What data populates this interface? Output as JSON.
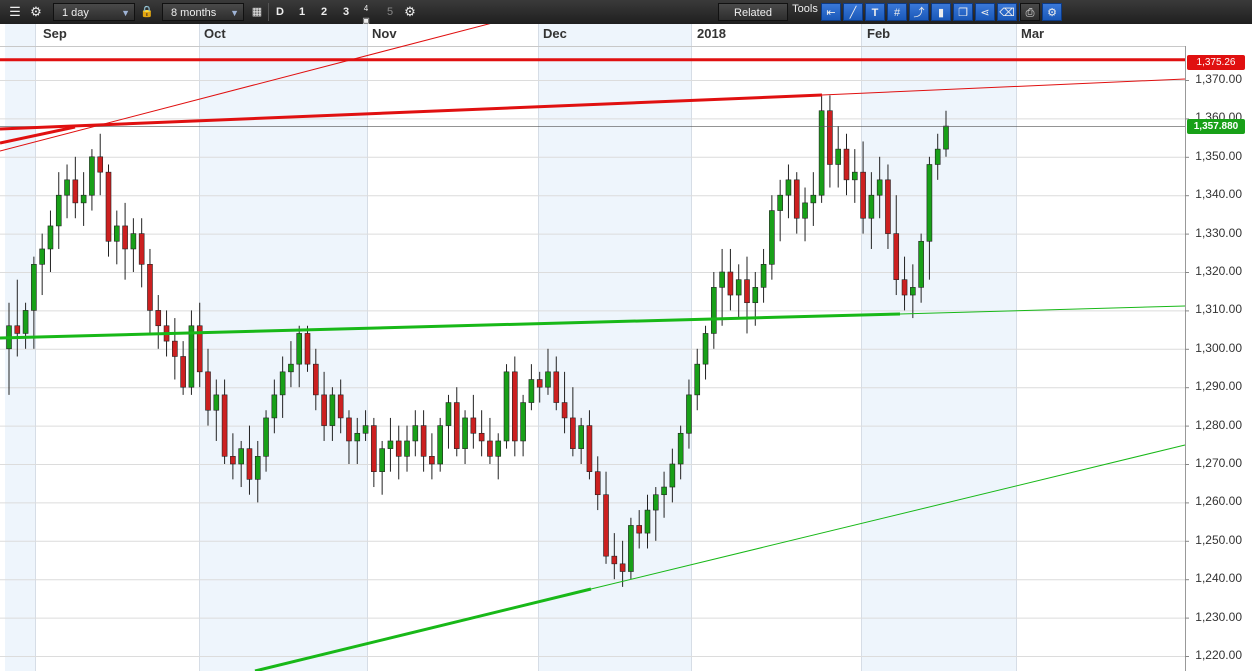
{
  "toolbar": {
    "interval": "1 day",
    "range": "8 months",
    "period_buttons": [
      "D",
      "1",
      "2",
      "3",
      "4",
      "5"
    ],
    "related_label": "Related",
    "tools_label": "Tools",
    "icons": [
      "list-icon",
      "gear-icon",
      "lock-icon",
      "calendar-icon",
      "settings-icon",
      "arrow-left-icon",
      "line-tool-icon",
      "text-tool-icon",
      "grid-icon",
      "trend-icon",
      "candle-icon",
      "copy-icon",
      "fork-icon",
      "eraser-icon",
      "brush-icon",
      "print-icon",
      "gear-icon"
    ]
  },
  "colors": {
    "up": "#18a018",
    "down": "#cc2020",
    "trend_red": "#e01010",
    "trend_green": "#18b818",
    "shade": "#eef5fc",
    "price_red": "#e01010",
    "price_green": "#18a018"
  },
  "chart_data": {
    "type": "candlestick",
    "instrument_price_last": "1,357.880",
    "resistance_level": "1,375.26",
    "x_labels": [
      "Sep",
      "Oct",
      "Nov",
      "Dec",
      "2018",
      "Feb",
      "Mar"
    ],
    "y_ticks": [
      "1,220.00",
      "1,230.00",
      "1,240.00",
      "1,250.00",
      "1,260.00",
      "1,270.00",
      "1,280.00",
      "1,290.00",
      "1,300.00",
      "1,310.00",
      "1,320.00",
      "1,330.00",
      "1,340.00",
      "1,350.00",
      "1,360.00",
      "1,370.00"
    ],
    "y_range": [
      1218,
      1385
    ],
    "candles": [
      [
        1300,
        1312,
        1288,
        1306
      ],
      [
        1306,
        1318,
        1298,
        1304
      ],
      [
        1304,
        1312,
        1300,
        1310
      ],
      [
        1310,
        1324,
        1300,
        1322
      ],
      [
        1322,
        1330,
        1314,
        1326
      ],
      [
        1326,
        1336,
        1320,
        1332
      ],
      [
        1332,
        1346,
        1326,
        1340
      ],
      [
        1340,
        1348,
        1334,
        1344
      ],
      [
        1344,
        1350,
        1334,
        1338
      ],
      [
        1338,
        1346,
        1332,
        1340
      ],
      [
        1340,
        1352,
        1336,
        1350
      ],
      [
        1350,
        1356,
        1340,
        1346
      ],
      [
        1346,
        1348,
        1324,
        1328
      ],
      [
        1328,
        1336,
        1322,
        1332
      ],
      [
        1332,
        1338,
        1318,
        1326
      ],
      [
        1326,
        1334,
        1320,
        1330
      ],
      [
        1330,
        1334,
        1316,
        1322
      ],
      [
        1322,
        1326,
        1304,
        1310
      ],
      [
        1310,
        1314,
        1300,
        1306
      ],
      [
        1306,
        1310,
        1298,
        1302
      ],
      [
        1302,
        1308,
        1292,
        1298
      ],
      [
        1298,
        1302,
        1288,
        1290
      ],
      [
        1290,
        1310,
        1288,
        1306
      ],
      [
        1306,
        1312,
        1290,
        1294
      ],
      [
        1294,
        1300,
        1280,
        1284
      ],
      [
        1284,
        1292,
        1276,
        1288
      ],
      [
        1288,
        1292,
        1270,
        1272
      ],
      [
        1272,
        1278,
        1266,
        1270
      ],
      [
        1270,
        1276,
        1264,
        1274
      ],
      [
        1274,
        1280,
        1262,
        1266
      ],
      [
        1266,
        1276,
        1260,
        1272
      ],
      [
        1272,
        1284,
        1268,
        1282
      ],
      [
        1282,
        1292,
        1278,
        1288
      ],
      [
        1288,
        1298,
        1282,
        1294
      ],
      [
        1294,
        1302,
        1290,
        1296
      ],
      [
        1296,
        1306,
        1290,
        1304
      ],
      [
        1304,
        1306,
        1294,
        1296
      ],
      [
        1296,
        1300,
        1284,
        1288
      ],
      [
        1288,
        1294,
        1276,
        1280
      ],
      [
        1280,
        1290,
        1276,
        1288
      ],
      [
        1288,
        1292,
        1278,
        1282
      ],
      [
        1282,
        1284,
        1270,
        1276
      ],
      [
        1276,
        1282,
        1270,
        1278
      ],
      [
        1278,
        1284,
        1276,
        1280
      ],
      [
        1280,
        1282,
        1264,
        1268
      ],
      [
        1268,
        1276,
        1262,
        1274
      ],
      [
        1274,
        1282,
        1268,
        1276
      ],
      [
        1276,
        1280,
        1266,
        1272
      ],
      [
        1272,
        1280,
        1268,
        1276
      ],
      [
        1276,
        1284,
        1272,
        1280
      ],
      [
        1280,
        1284,
        1268,
        1272
      ],
      [
        1272,
        1278,
        1266,
        1270
      ],
      [
        1270,
        1282,
        1268,
        1280
      ],
      [
        1280,
        1288,
        1274,
        1286
      ],
      [
        1286,
        1290,
        1272,
        1274
      ],
      [
        1274,
        1284,
        1270,
        1282
      ],
      [
        1282,
        1288,
        1274,
        1278
      ],
      [
        1278,
        1284,
        1272,
        1276
      ],
      [
        1276,
        1282,
        1270,
        1272
      ],
      [
        1272,
        1278,
        1266,
        1276
      ],
      [
        1276,
        1296,
        1274,
        1294
      ],
      [
        1294,
        1298,
        1272,
        1276
      ],
      [
        1276,
        1288,
        1272,
        1286
      ],
      [
        1286,
        1296,
        1284,
        1292
      ],
      [
        1292,
        1294,
        1286,
        1290
      ],
      [
        1290,
        1300,
        1288,
        1294
      ],
      [
        1294,
        1298,
        1284,
        1286
      ],
      [
        1286,
        1294,
        1278,
        1282
      ],
      [
        1282,
        1290,
        1272,
        1274
      ],
      [
        1274,
        1282,
        1270,
        1280
      ],
      [
        1280,
        1284,
        1266,
        1268
      ],
      [
        1268,
        1272,
        1258,
        1262
      ],
      [
        1262,
        1268,
        1244,
        1246
      ],
      [
        1246,
        1252,
        1240,
        1244
      ],
      [
        1244,
        1250,
        1238,
        1242
      ],
      [
        1242,
        1256,
        1240,
        1254
      ],
      [
        1254,
        1258,
        1248,
        1252
      ],
      [
        1252,
        1262,
        1248,
        1258
      ],
      [
        1258,
        1264,
        1250,
        1262
      ],
      [
        1262,
        1268,
        1256,
        1264
      ],
      [
        1264,
        1274,
        1260,
        1270
      ],
      [
        1270,
        1280,
        1266,
        1278
      ],
      [
        1278,
        1292,
        1274,
        1288
      ],
      [
        1288,
        1300,
        1284,
        1296
      ],
      [
        1296,
        1306,
        1292,
        1304
      ],
      [
        1304,
        1320,
        1300,
        1316
      ],
      [
        1316,
        1326,
        1306,
        1320
      ],
      [
        1320,
        1326,
        1310,
        1314
      ],
      [
        1314,
        1322,
        1308,
        1318
      ],
      [
        1318,
        1324,
        1304,
        1312
      ],
      [
        1312,
        1320,
        1306,
        1316
      ],
      [
        1316,
        1326,
        1312,
        1322
      ],
      [
        1322,
        1340,
        1318,
        1336
      ],
      [
        1336,
        1344,
        1328,
        1340
      ],
      [
        1340,
        1348,
        1334,
        1344
      ],
      [
        1344,
        1346,
        1330,
        1334
      ],
      [
        1334,
        1342,
        1328,
        1338
      ],
      [
        1338,
        1346,
        1332,
        1340
      ],
      [
        1340,
        1366,
        1338,
        1362
      ],
      [
        1362,
        1366,
        1342,
        1348
      ],
      [
        1348,
        1358,
        1342,
        1352
      ],
      [
        1352,
        1356,
        1340,
        1344
      ],
      [
        1344,
        1352,
        1338,
        1346
      ],
      [
        1346,
        1354,
        1330,
        1334
      ],
      [
        1334,
        1346,
        1326,
        1340
      ],
      [
        1340,
        1350,
        1334,
        1344
      ],
      [
        1344,
        1348,
        1326,
        1330
      ],
      [
        1330,
        1340,
        1314,
        1318
      ],
      [
        1318,
        1324,
        1310,
        1314
      ],
      [
        1314,
        1322,
        1308,
        1316
      ],
      [
        1316,
        1330,
        1312,
        1328
      ],
      [
        1328,
        1350,
        1318,
        1348
      ],
      [
        1348,
        1356,
        1344,
        1352
      ],
      [
        1352,
        1362,
        1350,
        1358
      ]
    ]
  }
}
